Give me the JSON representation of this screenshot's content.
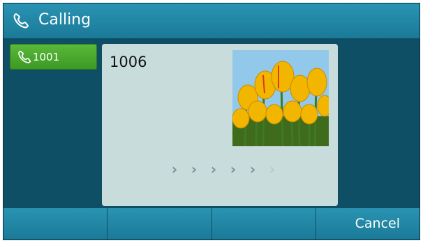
{
  "title": {
    "text": "Calling",
    "icon": "phone-handset-icon"
  },
  "line": {
    "label": "1001",
    "icon": "phone-handset-icon"
  },
  "call": {
    "callee": "1006",
    "photo": "tulips-contact-photo",
    "progress_arrows": 6,
    "progress_active": 5
  },
  "softkeys": [
    {
      "label": ""
    },
    {
      "label": ""
    },
    {
      "label": ""
    },
    {
      "label": "Cancel"
    }
  ],
  "colors": {
    "titlebar": "#1f86a5",
    "background": "#0f4f65",
    "card": "#c9dcdc",
    "line_active": "#4aab2f"
  }
}
